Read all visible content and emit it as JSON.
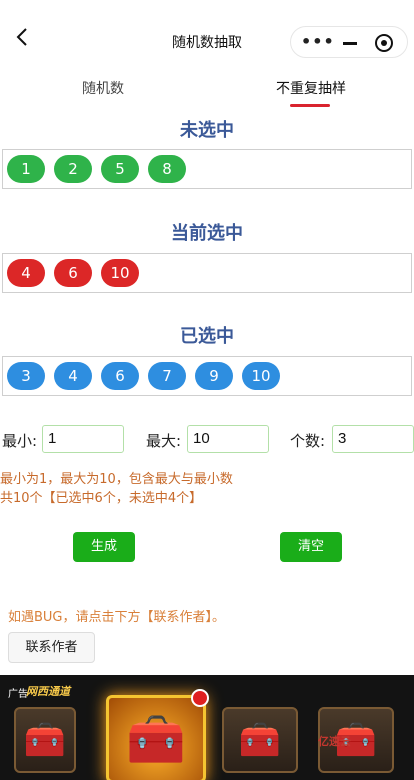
{
  "nav": {
    "title": "随机数抽取",
    "more_glyph": "•••"
  },
  "tabs": [
    {
      "label": "随机数"
    },
    {
      "label": "不重复抽样"
    }
  ],
  "unselected": {
    "title": "未选中",
    "numbers": [
      "1",
      "2",
      "5",
      "8"
    ]
  },
  "current": {
    "title": "当前选中",
    "numbers": [
      "4",
      "6",
      "10"
    ]
  },
  "selected": {
    "title": "已选中",
    "numbers": [
      "3",
      "4",
      "6",
      "7",
      "9",
      "10"
    ]
  },
  "params": {
    "min_label": "最小:",
    "min_value": "1",
    "max_label": "最大:",
    "max_value": "10",
    "count_label": "个数:",
    "count_value": "3"
  },
  "hint": {
    "line1": "最小为1，最大为10，包含最大与最小数",
    "line2": "共10个【已选中6个，未选中4个】"
  },
  "buttons": {
    "generate": "生成",
    "clear": "清空"
  },
  "bug_tip": "如遇BUG，请点击下方【联系作者】。",
  "contact_button": "联系作者",
  "ad": {
    "label": "广告",
    "brand": "网西通道",
    "watermark": "亿速云"
  },
  "colors": {
    "green_ball": "#2fb34a",
    "red_ball": "#dc2727",
    "blue_ball": "#2e8ee0",
    "title": "#3b5998",
    "button": "#1aad19",
    "tab_accent": "#d9232e"
  }
}
